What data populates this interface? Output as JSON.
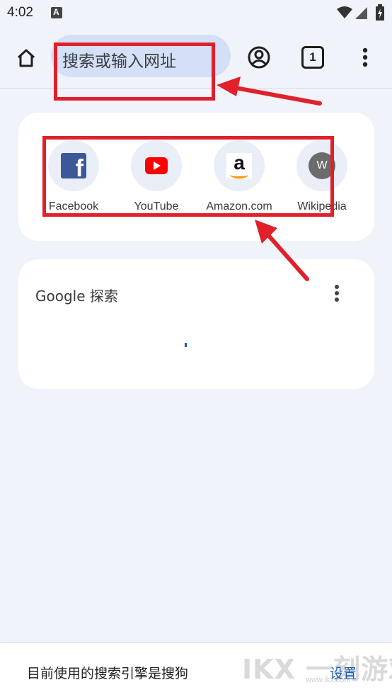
{
  "status_bar": {
    "time": "4:02",
    "notif_glyph": "A",
    "icons": [
      "wifi-icon",
      "signal-icon",
      "battery-icon"
    ]
  },
  "toolbar": {
    "omnibox_placeholder": "搜索或输入网址",
    "tab_count": "1",
    "icons": [
      "home-icon",
      "account-circle-icon",
      "more-vert-icon"
    ]
  },
  "shortcuts": [
    {
      "label": "Facebook",
      "icon": "facebook-icon"
    },
    {
      "label": "YouTube",
      "icon": "youtube-icon"
    },
    {
      "label": "Amazon.com",
      "icon": "amazon-icon",
      "glyph": "a"
    },
    {
      "label": "Wikipedia",
      "icon": "wikipedia-icon",
      "glyph": "W"
    }
  ],
  "search_card": {
    "title": "Google 探索"
  },
  "bottom_bar": {
    "message": "目前使用的搜索引擎是搜狗",
    "action": "设置"
  },
  "watermark": {
    "text": "IKX 一刻游戏网",
    "sub": "www.ikx.com"
  },
  "colors": {
    "annotation": "#e0202a",
    "omnibox_bg": "#d3e0f7",
    "page_bg": "#f0f3fa",
    "link": "#1a5cb8"
  }
}
